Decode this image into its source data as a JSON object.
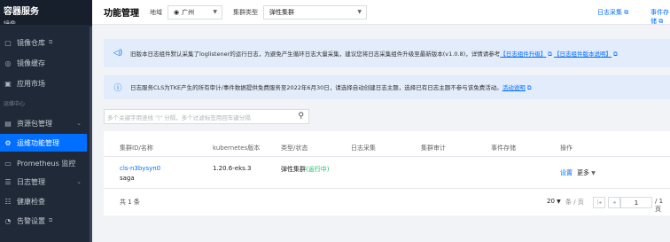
{
  "sidebar": {
    "title": "容器服务",
    "partial_item": "镜像...",
    "items": [
      {
        "label": "镜像仓库",
        "icon": "registry-icon",
        "ext": true
      },
      {
        "label": "镜像缓存",
        "icon": "cache-icon"
      },
      {
        "label": "应用市场",
        "icon": "market-icon"
      }
    ],
    "group_label": "运维中心",
    "ops_items": [
      {
        "label": "资源包管理",
        "icon": "package-icon",
        "chevron": true
      },
      {
        "label": "运维功能管理",
        "icon": "ops-icon",
        "active": true
      },
      {
        "label": "Prometheus 监控",
        "icon": "monitor-icon"
      },
      {
        "label": "日志管理",
        "icon": "log-icon",
        "chevron": true
      },
      {
        "label": "健康检查",
        "icon": "health-icon"
      },
      {
        "label": "告警设置",
        "icon": "alarm-icon",
        "ext": true
      }
    ]
  },
  "topbar": {
    "title": "功能管理",
    "region_label": "地域",
    "region_value": "广州",
    "cluster_type_label": "集群类型",
    "cluster_type_value": "弹性集群",
    "link_log_collect": "日志采集",
    "link_event_storage": "事件存储"
  },
  "banners": {
    "notice1": "旧版本日志组件默认采集了loglistener的运行日志，为避免产生循环日志大量采集，建议您将日志采集组件升级至最新版本(v1.0.8)，详情请参考",
    "notice1_link1": "【日志组件升级】",
    "notice1_link2": "【日志组件版本说明】",
    "notice2": "日志服务CLS为TKE产生的所有审计/事件数据提供免费服务至2022年6月30日，请选择自动创建日志主题，选择已有日志主题不参与该免费活动。",
    "notice2_link": "活动说明"
  },
  "search": {
    "placeholder": "多个关键字用竖线 \"|\" 分隔，多个过滤标签用回车键分隔"
  },
  "table": {
    "headers": [
      "集群ID/名称",
      "kubernetes版本",
      "类型/状态",
      "日志采集",
      "集群审计",
      "事件存储",
      "操作"
    ],
    "rows": [
      {
        "cluster_id": "cls-n3bysyn0",
        "cluster_name": "saga",
        "k8s_version": "1.20.6-eks.3",
        "type": "弹性集群",
        "status": "(运行中)",
        "action_settings": "设置",
        "action_more": "更多"
      }
    ],
    "total": "共 1 条",
    "page_size": "20",
    "page_size_unit": "条 / 页",
    "current_page": "1",
    "total_pages": "/ 1 页"
  },
  "colors": {
    "accent": "#006eff",
    "status_running": "#0abf5b"
  }
}
